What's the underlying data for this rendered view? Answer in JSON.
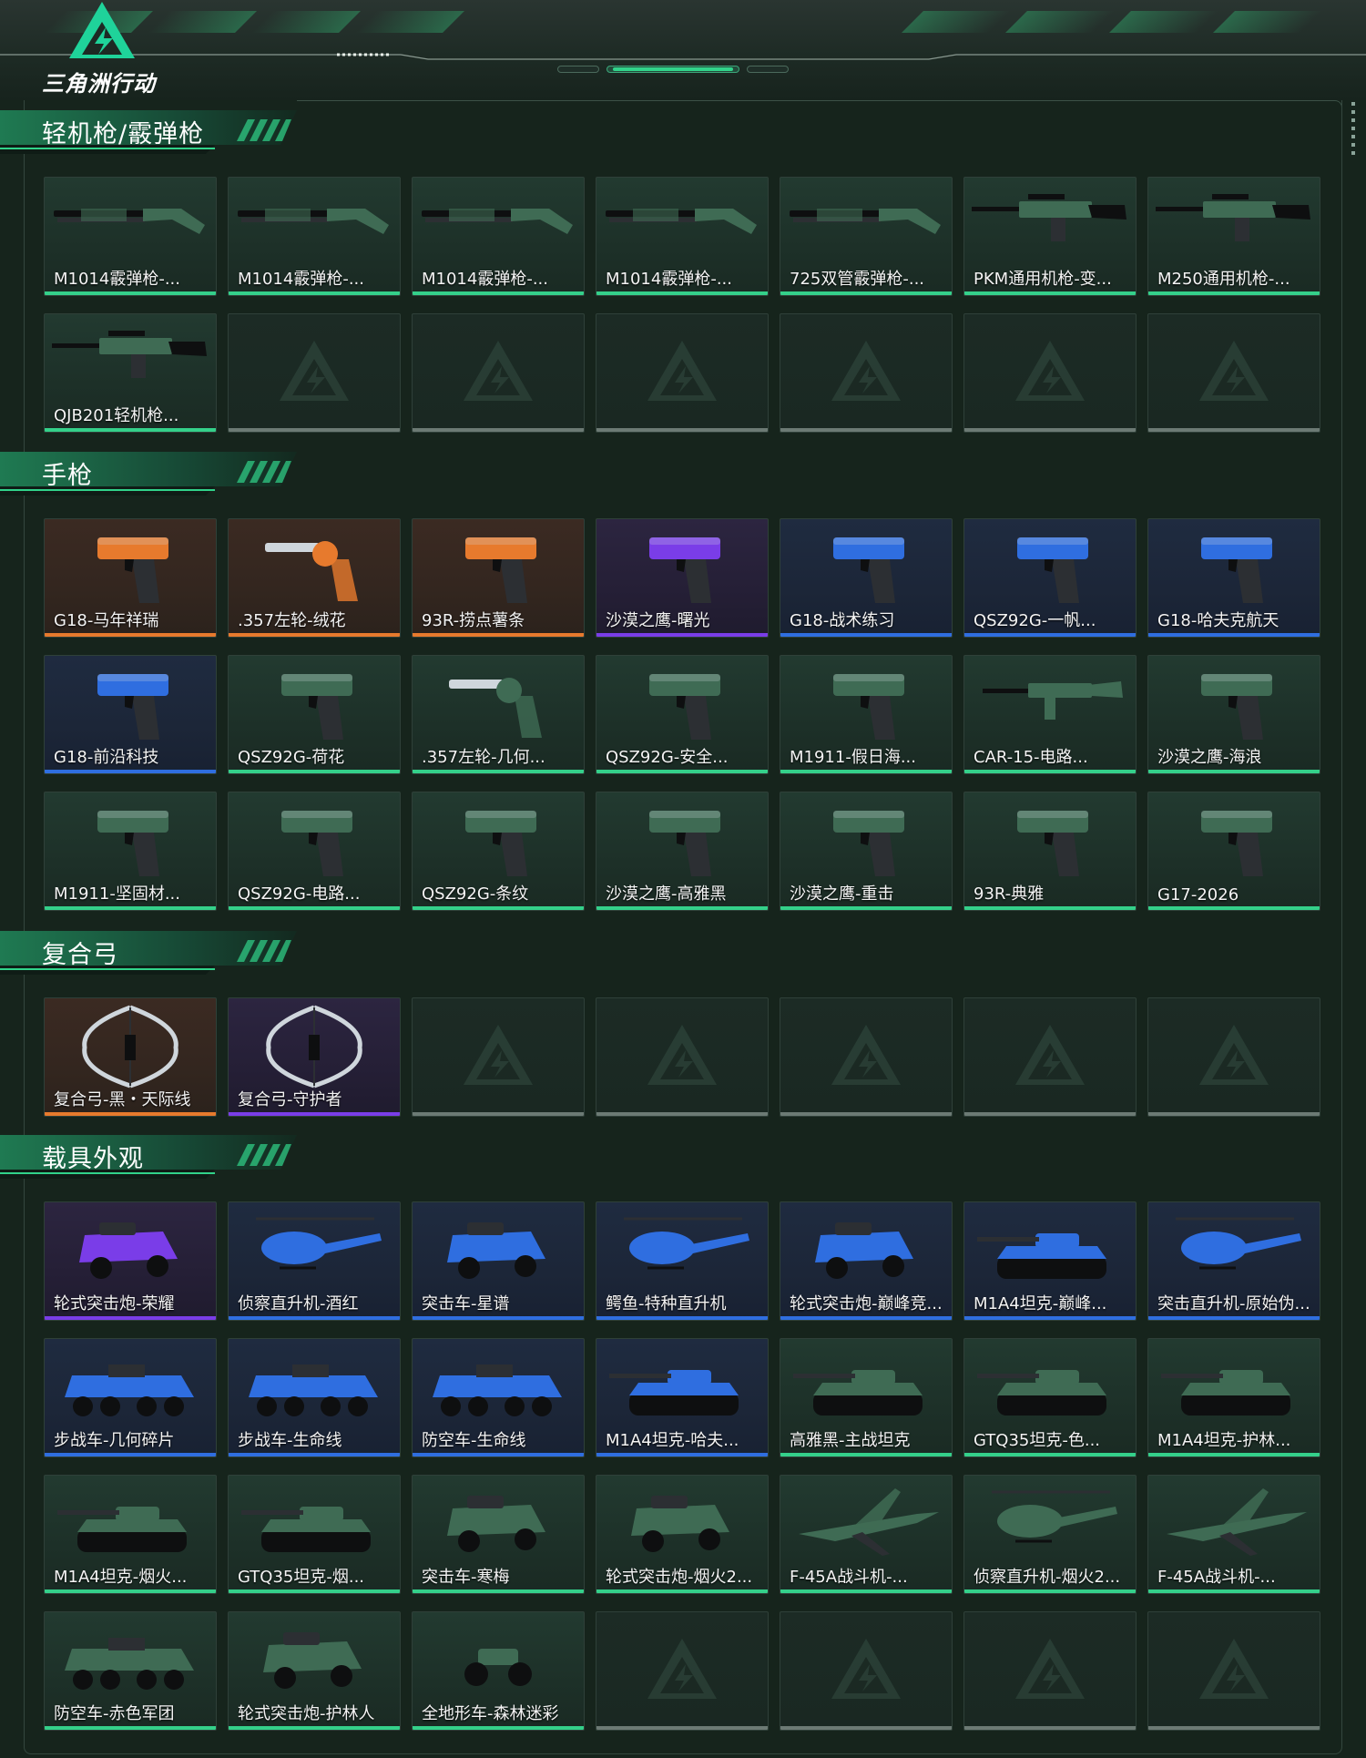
{
  "header": {
    "logo_text": "三角洲行动"
  },
  "colors": {
    "green": "#34d08a",
    "orange": "#e77a2d",
    "purple": "#7a3de8",
    "blue": "#2f6ee0",
    "empty": "#6c7a74"
  },
  "sections": [
    {
      "title": "轻机枪/霰弹枪",
      "items": [
        {
          "label": "M1014霰弹枪-...",
          "rarity": "green",
          "icon": "shotgun-icon"
        },
        {
          "label": "M1014霰弹枪-...",
          "rarity": "green",
          "icon": "shotgun-icon"
        },
        {
          "label": "M1014霰弹枪-...",
          "rarity": "green",
          "icon": "shotgun-icon"
        },
        {
          "label": "M1014霰弹枪-...",
          "rarity": "green",
          "icon": "shotgun-icon"
        },
        {
          "label": "725双管霰弹枪-...",
          "rarity": "green",
          "icon": "shotgun-icon"
        },
        {
          "label": "PKM通用机枪-变...",
          "rarity": "green",
          "icon": "machinegun-icon"
        },
        {
          "label": "M250通用机枪-...",
          "rarity": "green",
          "icon": "machinegun-icon"
        },
        {
          "label": "QJB201轻机枪...",
          "rarity": "green",
          "icon": "machinegun-icon"
        },
        {
          "label": "",
          "rarity": "empty"
        },
        {
          "label": "",
          "rarity": "empty"
        },
        {
          "label": "",
          "rarity": "empty"
        },
        {
          "label": "",
          "rarity": "empty"
        },
        {
          "label": "",
          "rarity": "empty"
        },
        {
          "label": "",
          "rarity": "empty"
        }
      ]
    },
    {
      "title": "手枪",
      "items": [
        {
          "label": "G18-马年祥瑞",
          "rarity": "orange",
          "icon": "pistol-icon"
        },
        {
          "label": ".357左轮-绒花",
          "rarity": "orange",
          "icon": "revolver-icon"
        },
        {
          "label": "93R-捞点薯条",
          "rarity": "orange",
          "icon": "pistol-icon"
        },
        {
          "label": "沙漠之鹰-曙光",
          "rarity": "purple",
          "icon": "pistol-icon"
        },
        {
          "label": "G18-战术练习",
          "rarity": "blue",
          "icon": "pistol-icon"
        },
        {
          "label": "QSZ92G-一帆...",
          "rarity": "blue",
          "icon": "pistol-icon"
        },
        {
          "label": "G18-哈夫克航天",
          "rarity": "blue",
          "icon": "pistol-icon"
        },
        {
          "label": "G18-前沿科技",
          "rarity": "blue",
          "icon": "pistol-icon"
        },
        {
          "label": "QSZ92G-荷花",
          "rarity": "green",
          "icon": "pistol-icon"
        },
        {
          "label": ".357左轮-几何...",
          "rarity": "green",
          "icon": "revolver-icon"
        },
        {
          "label": "QSZ92G-安全...",
          "rarity": "green",
          "icon": "pistol-icon"
        },
        {
          "label": "M1911-假日海...",
          "rarity": "green",
          "icon": "pistol-icon"
        },
        {
          "label": "CAR-15-电路...",
          "rarity": "green",
          "icon": "rifle-icon"
        },
        {
          "label": "沙漠之鹰-海浪",
          "rarity": "green",
          "icon": "pistol-icon"
        },
        {
          "label": "M1911-坚固材...",
          "rarity": "green",
          "icon": "pistol-icon"
        },
        {
          "label": "QSZ92G-电路...",
          "rarity": "green",
          "icon": "pistol-icon"
        },
        {
          "label": "QSZ92G-条纹",
          "rarity": "green",
          "icon": "pistol-icon"
        },
        {
          "label": "沙漠之鹰-高雅黑",
          "rarity": "green",
          "icon": "pistol-icon"
        },
        {
          "label": "沙漠之鹰-重击",
          "rarity": "green",
          "icon": "pistol-icon"
        },
        {
          "label": "93R-典雅",
          "rarity": "green",
          "icon": "pistol-icon"
        },
        {
          "label": "G17-2026",
          "rarity": "green",
          "icon": "pistol-icon"
        }
      ]
    },
    {
      "title": "复合弓",
      "items": [
        {
          "label": "复合弓-黑・天际线",
          "rarity": "orange",
          "icon": "bow-icon"
        },
        {
          "label": "复合弓-守护者",
          "rarity": "purple",
          "icon": "bow-icon"
        },
        {
          "label": "",
          "rarity": "empty"
        },
        {
          "label": "",
          "rarity": "empty"
        },
        {
          "label": "",
          "rarity": "empty"
        },
        {
          "label": "",
          "rarity": "empty"
        },
        {
          "label": "",
          "rarity": "empty"
        }
      ]
    },
    {
      "title": "载具外观",
      "items": [
        {
          "label": "轮式突击炮-荣耀",
          "rarity": "purple",
          "icon": "armored-car-icon"
        },
        {
          "label": "侦察直升机-酒红",
          "rarity": "blue",
          "icon": "helicopter-icon"
        },
        {
          "label": "突击车-星谱",
          "rarity": "blue",
          "icon": "armored-car-icon"
        },
        {
          "label": "鳄鱼-特种直升机",
          "rarity": "blue",
          "icon": "helicopter-icon"
        },
        {
          "label": "轮式突击炮-巅峰竞...",
          "rarity": "blue",
          "icon": "armored-car-icon"
        },
        {
          "label": "M1A4坦克-巅峰...",
          "rarity": "blue",
          "icon": "tank-icon"
        },
        {
          "label": "突击直升机-原始伪...",
          "rarity": "blue",
          "icon": "helicopter-icon"
        },
        {
          "label": "步战车-几何碎片",
          "rarity": "blue",
          "icon": "apc-icon"
        },
        {
          "label": "步战车-生命线",
          "rarity": "blue",
          "icon": "apc-icon"
        },
        {
          "label": "防空车-生命线",
          "rarity": "blue",
          "icon": "apc-icon"
        },
        {
          "label": "M1A4坦克-哈夫...",
          "rarity": "blue",
          "icon": "tank-icon"
        },
        {
          "label": "高雅黑-主战坦克",
          "rarity": "green",
          "icon": "tank-icon"
        },
        {
          "label": "GTQ35坦克-色...",
          "rarity": "green",
          "icon": "tank-icon"
        },
        {
          "label": "M1A4坦克-护林...",
          "rarity": "green",
          "icon": "tank-icon"
        },
        {
          "label": "M1A4坦克-烟火...",
          "rarity": "green",
          "icon": "tank-icon"
        },
        {
          "label": "GTQ35坦克-烟...",
          "rarity": "green",
          "icon": "tank-icon"
        },
        {
          "label": "突击车-寒梅",
          "rarity": "green",
          "icon": "armored-car-icon"
        },
        {
          "label": "轮式突击炮-烟火2...",
          "rarity": "green",
          "icon": "armored-car-icon"
        },
        {
          "label": "F-45A战斗机-...",
          "rarity": "green",
          "icon": "fighter-jet-icon"
        },
        {
          "label": "侦察直升机-烟火2...",
          "rarity": "green",
          "icon": "helicopter-icon"
        },
        {
          "label": "F-45A战斗机-...",
          "rarity": "green",
          "icon": "fighter-jet-icon"
        },
        {
          "label": "防空车-赤色军团",
          "rarity": "green",
          "icon": "apc-icon"
        },
        {
          "label": "轮式突击炮-护林人",
          "rarity": "green",
          "icon": "armored-car-icon"
        },
        {
          "label": "全地形车-森林迷彩",
          "rarity": "green",
          "icon": "atv-icon"
        },
        {
          "label": "",
          "rarity": "empty"
        },
        {
          "label": "",
          "rarity": "empty"
        },
        {
          "label": "",
          "rarity": "empty"
        },
        {
          "label": "",
          "rarity": "empty"
        }
      ]
    }
  ]
}
